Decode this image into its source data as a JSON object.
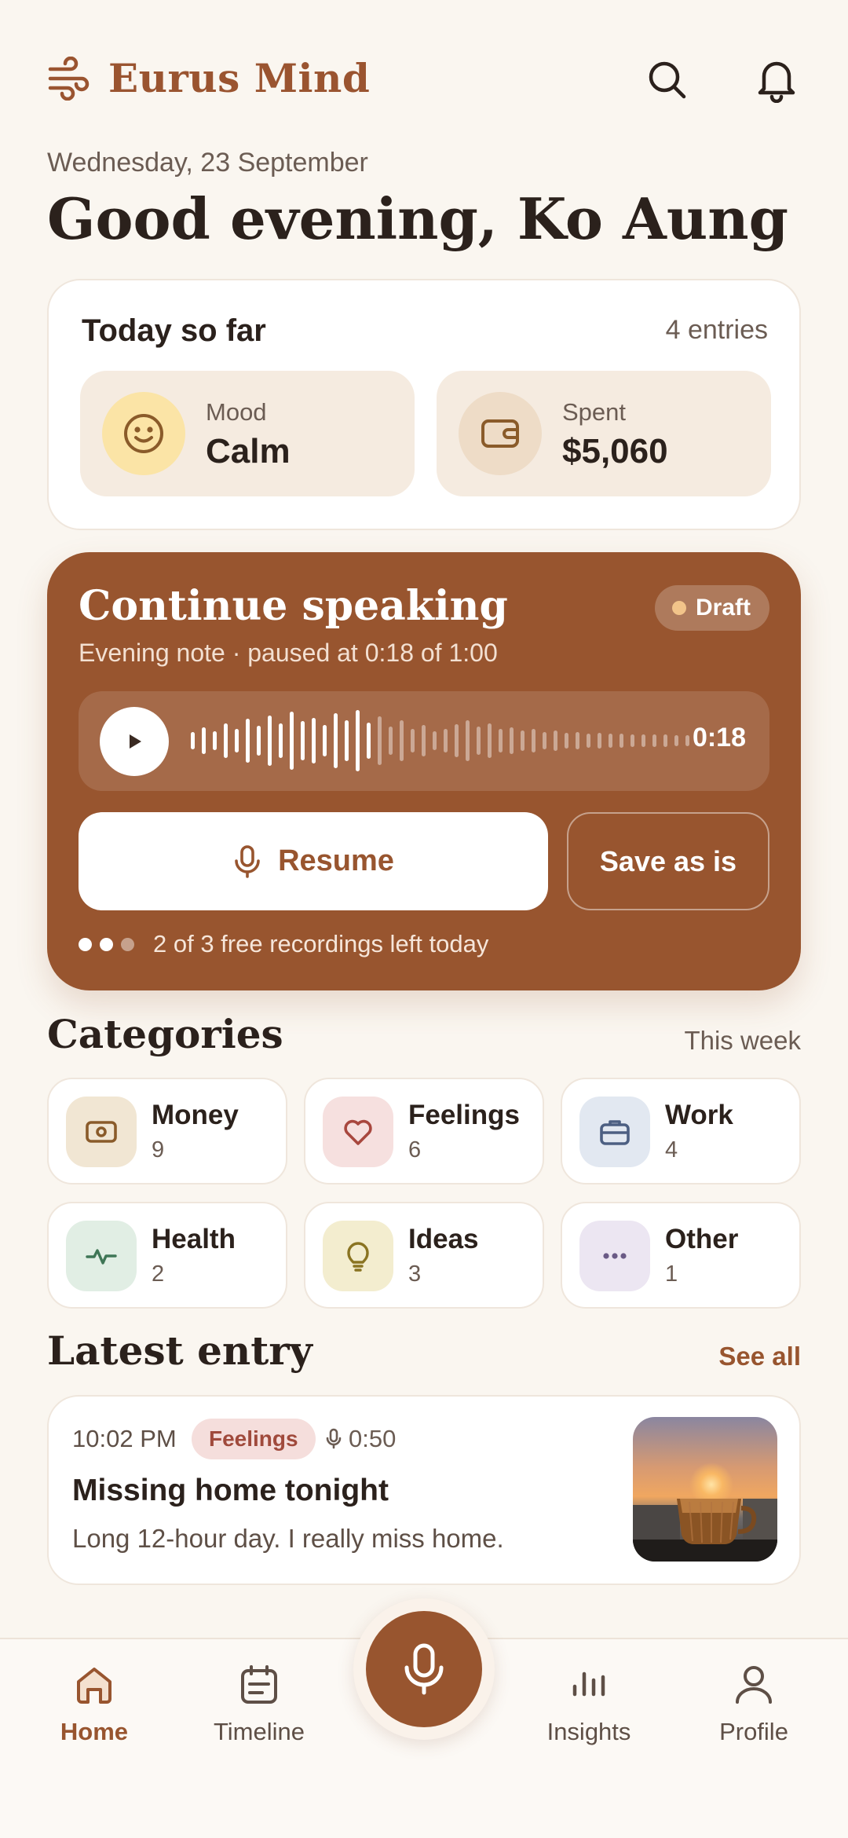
{
  "app": {
    "name": "Eurus Mind"
  },
  "header": {
    "date": "Wednesday, 23 September",
    "greeting": "Good evening, Ko Aung"
  },
  "today": {
    "title": "Today so far",
    "entries": "4 entries",
    "mood": {
      "label": "Mood",
      "value": "Calm",
      "icon": "smile-icon"
    },
    "spent": {
      "label": "Spent",
      "value": "$5,060",
      "icon": "wallet-icon"
    }
  },
  "recording": {
    "title": "Continue speaking",
    "subtitle": "Evening note · paused at 0:18 of 1:00",
    "badge": "Draft",
    "time": "0:18",
    "progress": 0.3,
    "resume_label": "Resume",
    "save_label": "Save as is",
    "quota_text": "2 of 3 free recordings left today",
    "quota_used": 2,
    "quota_total": 3
  },
  "categories": {
    "title": "Categories",
    "period": "This week",
    "items": [
      {
        "name": "Money",
        "count": "9",
        "icon": "money-icon",
        "bg": "#F1E6D3",
        "fg": "#8A5B2A"
      },
      {
        "name": "Feelings",
        "count": "6",
        "icon": "heart-icon",
        "bg": "#F6E0DF",
        "fg": "#A8473E"
      },
      {
        "name": "Work",
        "count": "4",
        "icon": "briefcase-icon",
        "bg": "#E2E8F1",
        "fg": "#4C5F82"
      },
      {
        "name": "Health",
        "count": "2",
        "icon": "pulse-icon",
        "bg": "#E1EEE4",
        "fg": "#3F7656"
      },
      {
        "name": "Ideas",
        "count": "3",
        "icon": "lightbulb-icon",
        "bg": "#F3EDCF",
        "fg": "#8A7422"
      },
      {
        "name": "Other",
        "count": "1",
        "icon": "more-icon",
        "bg": "#ECE6F2",
        "fg": "#6A5A86"
      }
    ]
  },
  "latest": {
    "title": "Latest entry",
    "see_all": "See all",
    "entry": {
      "time": "10:02 PM",
      "tag": "Feelings",
      "duration": "0:50",
      "title": "Missing home tonight",
      "body": "Long 12-hour day. I really miss home."
    }
  },
  "nav": {
    "items": [
      {
        "label": "Home",
        "icon": "home-icon",
        "active": true
      },
      {
        "label": "Timeline",
        "icon": "calendar-icon"
      },
      {
        "label": "Insights",
        "icon": "bar-chart-icon"
      },
      {
        "label": "Profile",
        "icon": "user-icon"
      }
    ],
    "record_icon": "microphone-icon"
  },
  "colors": {
    "accent": "#98552F",
    "background": "#FAF6F0"
  }
}
